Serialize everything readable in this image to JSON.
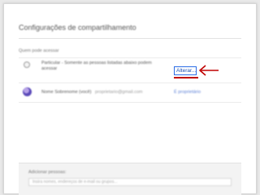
{
  "dialog": {
    "title": "Configurações de compartilhamento"
  },
  "access": {
    "section_label": "Quem pode acessar",
    "rows": [
      {
        "icon": "globe-icon",
        "text": "Particular - Somente as pessoas listadas abaixo podem acessar",
        "action_label": "Alterar..."
      },
      {
        "icon": "avatar",
        "name": "Nome Sobrenome (você)",
        "email": "proprietario@gmail.com",
        "role": "É proprietário"
      }
    ]
  },
  "invite": {
    "label": "Adicionar pessoas:",
    "placeholder": "Insira nomes, endereços de e-mail ou grupos..."
  },
  "colors": {
    "annotation_arrow": "#c00000",
    "button_border": "#2b6de6"
  }
}
